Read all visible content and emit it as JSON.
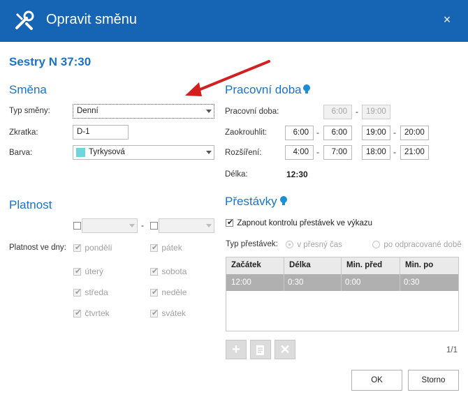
{
  "dialog": {
    "title": "Opravit směnu",
    "close_icon": "×"
  },
  "shift_heading": "Sestry N 37:30",
  "smena": {
    "section_title": "Směna",
    "typ_label": "Typ směny:",
    "typ_value": "Denní",
    "zkratka_label": "Zkratka:",
    "zkratka_value": "D-1",
    "barva_label": "Barva:",
    "barva_value": "Tyrkysová",
    "barva_color": "#6fd6dc"
  },
  "pracovni_doba": {
    "section_title": "Pracovní doba",
    "doba_label": "Pracovní doba:",
    "doba_from": "6:00",
    "doba_to": "19:00",
    "zaokrouhlit_label": "Zaokrouhlit:",
    "zaokrouhlit": [
      "6:00",
      "6:00",
      "19:00",
      "20:00"
    ],
    "rozsireni_label": "Rozšíření:",
    "rozsireni": [
      "4:00",
      "7:00",
      "18:00",
      "21:00"
    ],
    "delka_label": "Délka:",
    "delka_value": "12:30"
  },
  "platnost": {
    "section_title": "Platnost",
    "dny_label": "Platnost ve dny:",
    "days": [
      "pondělí",
      "úterý",
      "středa",
      "čtvrtek",
      "pátek",
      "sobota",
      "neděle",
      "svátek"
    ]
  },
  "prestavky": {
    "section_title": "Přestávky",
    "kontrola_label": "Zapnout kontrolu přestávek ve výkazu",
    "typ_label": "Typ přestávek:",
    "option_1": "v přesný čas",
    "option_2": "po odpracované době",
    "columns": [
      "Začátek",
      "Délka",
      "Min. před",
      "Min. po"
    ],
    "rows": [
      [
        "12:00",
        "0:30",
        "0:00",
        "0:30"
      ]
    ],
    "page_info": "1/1"
  },
  "buttons": {
    "ok": "OK",
    "storno": "Storno"
  },
  "colors": {
    "titlebar": "#1565b4",
    "accent": "#1a73c9",
    "arrow": "#d21f1f"
  }
}
